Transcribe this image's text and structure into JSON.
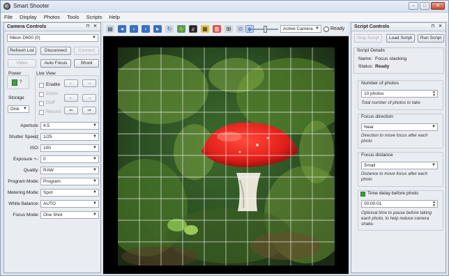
{
  "window": {
    "title": "Smart Shooter"
  },
  "menu": [
    "File",
    "Display",
    "Photos",
    "Tools",
    "Scripts",
    "Help"
  ],
  "camera_controls": {
    "title": "Camera Controls",
    "camera": "Nikon D600 (0)",
    "buttons": {
      "refresh": "Refresh List",
      "disconnect": "Disconnect",
      "connect": "Connect",
      "video": "Video",
      "autofocus": "Auto Focus",
      "shoot": "Shoot"
    },
    "power_label": "Power",
    "power_value": "?",
    "live_view_label": "Live View",
    "live_view_options": [
      "Enable",
      "Zoom",
      "DOF",
      "Record"
    ],
    "storage_label": "Storage",
    "storage_value": "Disk",
    "settings": [
      {
        "label": "Aperture:",
        "value": "4.5"
      },
      {
        "label": "Shutter Speed:",
        "value": "1/25"
      },
      {
        "label": "ISO:",
        "value": "100"
      },
      {
        "label": "Exposure +-:",
        "value": "0"
      },
      {
        "label": "Quality:",
        "value": "RAW"
      },
      {
        "label": "Program Mode:",
        "value": "Program"
      },
      {
        "label": "Metering Mode:",
        "value": "Spot"
      },
      {
        "label": "White Balance:",
        "value": "AUTO"
      },
      {
        "label": "Focus Mode:",
        "value": "One Shot"
      }
    ]
  },
  "viewer": {
    "camera_select": "Active Camera",
    "status": "Ready"
  },
  "script_controls": {
    "title": "Script Controls",
    "buttons": {
      "stop": "Stop Script",
      "load": "Load Script",
      "run": "Run Script"
    },
    "details_label": "Script Details",
    "name_label": "Name:",
    "name_value": "Focus stacking",
    "status_label": "Status:",
    "status_value": "Ready",
    "params": [
      {
        "label": "Number of photos",
        "value": "10 photos",
        "help": "Total number of photos to take"
      },
      {
        "label": "Focus direction",
        "value": "Near",
        "help": "Direction to move focus after each photo"
      },
      {
        "label": "Focus distance",
        "value": "Small",
        "help": "Distance to move focus after each photo"
      },
      {
        "label": "Time delay before photo",
        "value": "00:00:01",
        "help": "Optional time to pause before taking each photo, to help reduce camera shake."
      }
    ]
  },
  "colors": {
    "accent_green": "#3a9b3a",
    "mushroom_cap": "#e3201b"
  }
}
